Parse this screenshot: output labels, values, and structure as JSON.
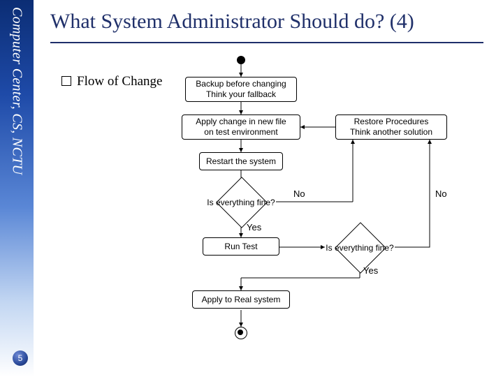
{
  "sidebar": {
    "label": "Computer Center, CS, NCTU"
  },
  "slide": {
    "title": "What System Administrator Should do? (4)",
    "page_number": "5",
    "bullet_label": "Flow of Change"
  },
  "chart_data": {
    "type": "flowchart",
    "title": "Flow of Change",
    "nodes": [
      {
        "id": "start",
        "kind": "start",
        "label": ""
      },
      {
        "id": "backup",
        "kind": "process",
        "label": "Backup before changing\nThink your fallback"
      },
      {
        "id": "apply",
        "kind": "process",
        "label": "Apply change in new file\non test environment"
      },
      {
        "id": "restart",
        "kind": "process",
        "label": "Restart the system"
      },
      {
        "id": "d1",
        "kind": "decision",
        "label": "Is everything fine?"
      },
      {
        "id": "runtest",
        "kind": "process",
        "label": "Run Test"
      },
      {
        "id": "d2",
        "kind": "decision",
        "label": "Is everything fine?"
      },
      {
        "id": "restore",
        "kind": "process",
        "label": "Restore Procedures\nThink another solution"
      },
      {
        "id": "applyreal",
        "kind": "process",
        "label": "Apply to Real system"
      },
      {
        "id": "end",
        "kind": "end",
        "label": ""
      }
    ],
    "edges": [
      {
        "from": "start",
        "to": "backup",
        "label": ""
      },
      {
        "from": "backup",
        "to": "apply",
        "label": ""
      },
      {
        "from": "apply",
        "to": "restart",
        "label": ""
      },
      {
        "from": "restart",
        "to": "d1",
        "label": ""
      },
      {
        "from": "d1",
        "to": "runtest",
        "label": "Yes"
      },
      {
        "from": "d1",
        "to": "restore",
        "label": "No"
      },
      {
        "from": "runtest",
        "to": "d2",
        "label": ""
      },
      {
        "from": "d2",
        "to": "applyreal",
        "label": "Yes"
      },
      {
        "from": "d2",
        "to": "restore",
        "label": "No"
      },
      {
        "from": "restore",
        "to": "apply",
        "label": ""
      },
      {
        "from": "applyreal",
        "to": "end",
        "label": ""
      }
    ],
    "edge_labels": {
      "yes": "Yes",
      "no": "No"
    }
  }
}
